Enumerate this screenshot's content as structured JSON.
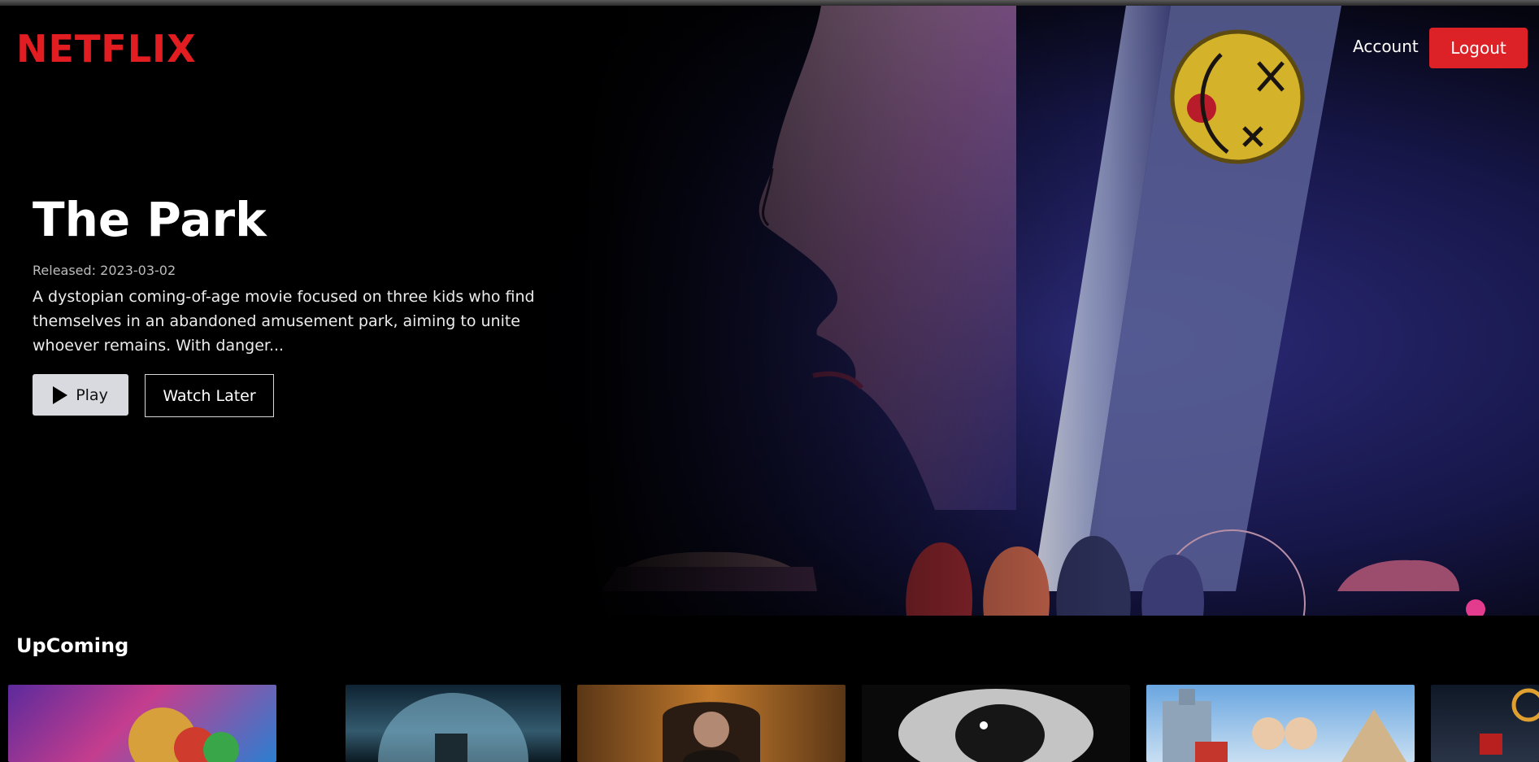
{
  "header": {
    "logo": "NETFLIX",
    "account_label": "Account",
    "logout_label": "Logout"
  },
  "hero": {
    "title": "The Park",
    "release": "Released: 2023-03-02",
    "description": "A dystopian coming-of-age movie focused on three kids who find themselves in an abandoned amusement park, aiming to unite whoever remains. With danger...",
    "play_label": "Play",
    "watch_later_label": "Watch Later"
  },
  "row": {
    "title": "UpComing",
    "cards": [
      {
        "name": "movie-card-1"
      },
      {
        "name": "movie-card-2"
      },
      {
        "name": "movie-card-3"
      },
      {
        "name": "movie-card-4"
      },
      {
        "name": "movie-card-5"
      },
      {
        "name": "movie-card-6"
      }
    ]
  },
  "colors": {
    "brand": "#e11d22",
    "logout": "#dc2226",
    "background": "#000000"
  }
}
